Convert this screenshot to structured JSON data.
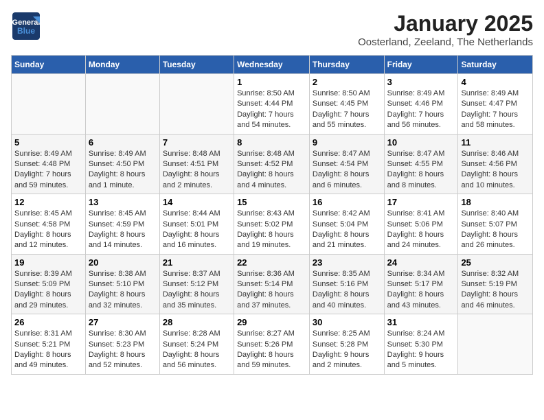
{
  "logo": {
    "line1": "General",
    "line2": "Blue"
  },
  "header": {
    "month": "January 2025",
    "location": "Oosterland, Zeeland, The Netherlands"
  },
  "weekdays": [
    "Sunday",
    "Monday",
    "Tuesday",
    "Wednesday",
    "Thursday",
    "Friday",
    "Saturday"
  ],
  "weeks": [
    [
      {
        "day": "",
        "info": ""
      },
      {
        "day": "",
        "info": ""
      },
      {
        "day": "",
        "info": ""
      },
      {
        "day": "1",
        "info": "Sunrise: 8:50 AM\nSunset: 4:44 PM\nDaylight: 7 hours\nand 54 minutes."
      },
      {
        "day": "2",
        "info": "Sunrise: 8:50 AM\nSunset: 4:45 PM\nDaylight: 7 hours\nand 55 minutes."
      },
      {
        "day": "3",
        "info": "Sunrise: 8:49 AM\nSunset: 4:46 PM\nDaylight: 7 hours\nand 56 minutes."
      },
      {
        "day": "4",
        "info": "Sunrise: 8:49 AM\nSunset: 4:47 PM\nDaylight: 7 hours\nand 58 minutes."
      }
    ],
    [
      {
        "day": "5",
        "info": "Sunrise: 8:49 AM\nSunset: 4:48 PM\nDaylight: 7 hours\nand 59 minutes."
      },
      {
        "day": "6",
        "info": "Sunrise: 8:49 AM\nSunset: 4:50 PM\nDaylight: 8 hours\nand 1 minute."
      },
      {
        "day": "7",
        "info": "Sunrise: 8:48 AM\nSunset: 4:51 PM\nDaylight: 8 hours\nand 2 minutes."
      },
      {
        "day": "8",
        "info": "Sunrise: 8:48 AM\nSunset: 4:52 PM\nDaylight: 8 hours\nand 4 minutes."
      },
      {
        "day": "9",
        "info": "Sunrise: 8:47 AM\nSunset: 4:54 PM\nDaylight: 8 hours\nand 6 minutes."
      },
      {
        "day": "10",
        "info": "Sunrise: 8:47 AM\nSunset: 4:55 PM\nDaylight: 8 hours\nand 8 minutes."
      },
      {
        "day": "11",
        "info": "Sunrise: 8:46 AM\nSunset: 4:56 PM\nDaylight: 8 hours\nand 10 minutes."
      }
    ],
    [
      {
        "day": "12",
        "info": "Sunrise: 8:45 AM\nSunset: 4:58 PM\nDaylight: 8 hours\nand 12 minutes."
      },
      {
        "day": "13",
        "info": "Sunrise: 8:45 AM\nSunset: 4:59 PM\nDaylight: 8 hours\nand 14 minutes."
      },
      {
        "day": "14",
        "info": "Sunrise: 8:44 AM\nSunset: 5:01 PM\nDaylight: 8 hours\nand 16 minutes."
      },
      {
        "day": "15",
        "info": "Sunrise: 8:43 AM\nSunset: 5:02 PM\nDaylight: 8 hours\nand 19 minutes."
      },
      {
        "day": "16",
        "info": "Sunrise: 8:42 AM\nSunset: 5:04 PM\nDaylight: 8 hours\nand 21 minutes."
      },
      {
        "day": "17",
        "info": "Sunrise: 8:41 AM\nSunset: 5:06 PM\nDaylight: 8 hours\nand 24 minutes."
      },
      {
        "day": "18",
        "info": "Sunrise: 8:40 AM\nSunset: 5:07 PM\nDaylight: 8 hours\nand 26 minutes."
      }
    ],
    [
      {
        "day": "19",
        "info": "Sunrise: 8:39 AM\nSunset: 5:09 PM\nDaylight: 8 hours\nand 29 minutes."
      },
      {
        "day": "20",
        "info": "Sunrise: 8:38 AM\nSunset: 5:10 PM\nDaylight: 8 hours\nand 32 minutes."
      },
      {
        "day": "21",
        "info": "Sunrise: 8:37 AM\nSunset: 5:12 PM\nDaylight: 8 hours\nand 35 minutes."
      },
      {
        "day": "22",
        "info": "Sunrise: 8:36 AM\nSunset: 5:14 PM\nDaylight: 8 hours\nand 37 minutes."
      },
      {
        "day": "23",
        "info": "Sunrise: 8:35 AM\nSunset: 5:16 PM\nDaylight: 8 hours\nand 40 minutes."
      },
      {
        "day": "24",
        "info": "Sunrise: 8:34 AM\nSunset: 5:17 PM\nDaylight: 8 hours\nand 43 minutes."
      },
      {
        "day": "25",
        "info": "Sunrise: 8:32 AM\nSunset: 5:19 PM\nDaylight: 8 hours\nand 46 minutes."
      }
    ],
    [
      {
        "day": "26",
        "info": "Sunrise: 8:31 AM\nSunset: 5:21 PM\nDaylight: 8 hours\nand 49 minutes."
      },
      {
        "day": "27",
        "info": "Sunrise: 8:30 AM\nSunset: 5:23 PM\nDaylight: 8 hours\nand 52 minutes."
      },
      {
        "day": "28",
        "info": "Sunrise: 8:28 AM\nSunset: 5:24 PM\nDaylight: 8 hours\nand 56 minutes."
      },
      {
        "day": "29",
        "info": "Sunrise: 8:27 AM\nSunset: 5:26 PM\nDaylight: 8 hours\nand 59 minutes."
      },
      {
        "day": "30",
        "info": "Sunrise: 8:25 AM\nSunset: 5:28 PM\nDaylight: 9 hours\nand 2 minutes."
      },
      {
        "day": "31",
        "info": "Sunrise: 8:24 AM\nSunset: 5:30 PM\nDaylight: 9 hours\nand 5 minutes."
      },
      {
        "day": "",
        "info": ""
      }
    ]
  ]
}
